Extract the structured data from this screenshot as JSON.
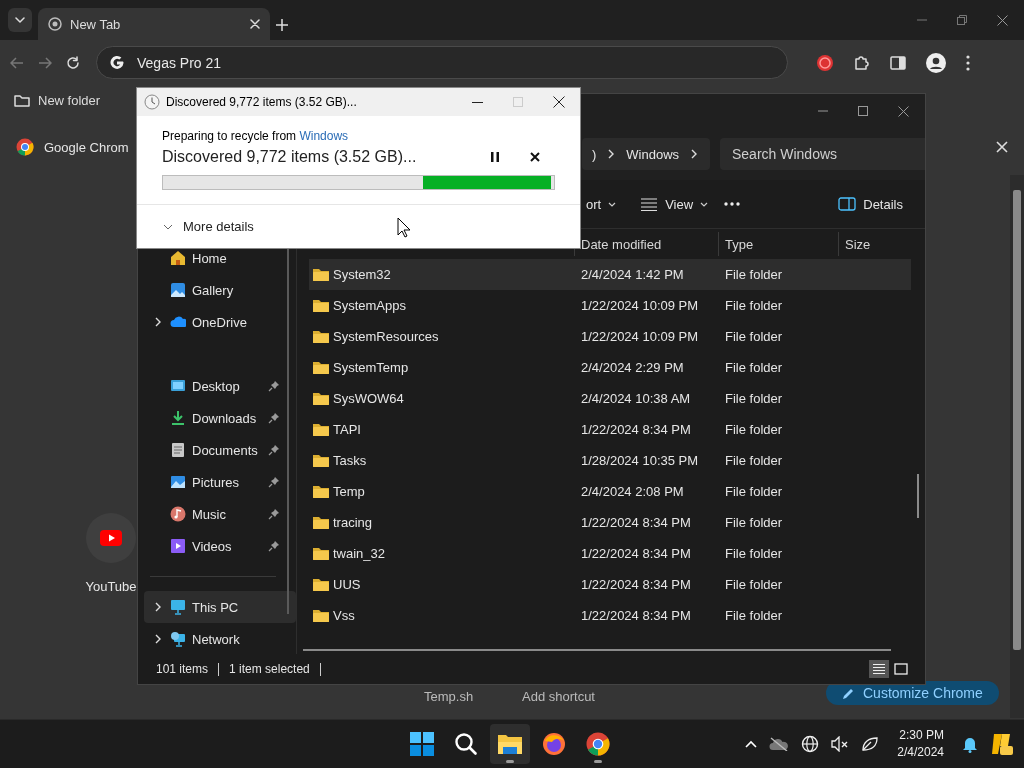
{
  "browser": {
    "tabs": [
      {
        "title": "New Tab",
        "selected": true
      }
    ],
    "omnibox": {
      "value": "Vegas Pro 21"
    },
    "bookmarks": [
      {
        "label": "New folder"
      }
    ],
    "infobar": {
      "text": "Google Chrom"
    },
    "shortcuts": [
      {
        "label": "YouTube",
        "kind": "youtube"
      }
    ],
    "shortcut_labels": [
      "Temp.sh",
      "Add shortcut"
    ],
    "customize_button": "Customize Chrome"
  },
  "explorer": {
    "breadcrumb": [
      ")",
      "Windows"
    ],
    "search": {
      "placeholder": "Search Windows"
    },
    "toolbar": [
      {
        "label": "ort",
        "kind": "dropdown"
      },
      {
        "label": "View",
        "kind": "view"
      },
      {
        "kind": "more"
      },
      {
        "label": "Details",
        "kind": "details"
      }
    ],
    "sidebar": [
      {
        "divider": false,
        "items": [
          {
            "label": "Home",
            "kind": "home",
            "pinned": false,
            "has_children": false,
            "selected": false
          },
          {
            "label": "Gallery",
            "kind": "gallery",
            "pinned": false,
            "has_children": false,
            "selected": false
          },
          {
            "label": "OneDrive",
            "kind": "onedrive",
            "pinned": false,
            "has_children": true,
            "selected": false
          }
        ]
      },
      {
        "divider": false,
        "items": [
          {
            "label": "Desktop",
            "kind": "desktop",
            "pinned": true,
            "has_children": false,
            "selected": false
          },
          {
            "label": "Downloads",
            "kind": "downloads",
            "pinned": true,
            "has_children": false,
            "selected": false
          },
          {
            "label": "Documents",
            "kind": "documents",
            "pinned": true,
            "has_children": false,
            "selected": false
          },
          {
            "label": "Pictures",
            "kind": "pictures",
            "pinned": true,
            "has_children": false,
            "selected": false
          },
          {
            "label": "Music",
            "kind": "music",
            "pinned": true,
            "has_children": false,
            "selected": false
          },
          {
            "label": "Videos",
            "kind": "videos",
            "pinned": true,
            "has_children": false,
            "selected": false
          }
        ]
      },
      {
        "divider": true,
        "items": [
          {
            "label": "This PC",
            "kind": "thispc",
            "pinned": false,
            "has_children": true,
            "selected": true
          },
          {
            "label": "Network",
            "kind": "network",
            "pinned": false,
            "has_children": true,
            "selected": false
          }
        ]
      }
    ],
    "columns": [
      "Date modified",
      "Type",
      "Size"
    ],
    "rows": [
      {
        "name": "System32",
        "date": "2/4/2024 1:42 PM",
        "type": "File folder",
        "selected": true
      },
      {
        "name": "SystemApps",
        "date": "1/22/2024 10:09 PM",
        "type": "File folder",
        "selected": false
      },
      {
        "name": "SystemResources",
        "date": "1/22/2024 10:09 PM",
        "type": "File folder",
        "selected": false
      },
      {
        "name": "SystemTemp",
        "date": "2/4/2024 2:29 PM",
        "type": "File folder",
        "selected": false
      },
      {
        "name": "SysWOW64",
        "date": "2/4/2024 10:38 AM",
        "type": "File folder",
        "selected": false
      },
      {
        "name": "TAPI",
        "date": "1/22/2024 8:34 PM",
        "type": "File folder",
        "selected": false
      },
      {
        "name": "Tasks",
        "date": "1/28/2024 10:35 PM",
        "type": "File folder",
        "selected": false
      },
      {
        "name": "Temp",
        "date": "2/4/2024 2:08 PM",
        "type": "File folder",
        "selected": false
      },
      {
        "name": "tracing",
        "date": "1/22/2024 8:34 PM",
        "type": "File folder",
        "selected": false
      },
      {
        "name": "twain_32",
        "date": "1/22/2024 8:34 PM",
        "type": "File folder",
        "selected": false
      },
      {
        "name": "UUS",
        "date": "1/22/2024 8:34 PM",
        "type": "File folder",
        "selected": false
      },
      {
        "name": "Vss",
        "date": "1/22/2024 8:34 PM",
        "type": "File folder",
        "selected": false
      }
    ],
    "status": [
      "101 items",
      "1 item selected"
    ],
    "view_modes": [
      {
        "kind": "details",
        "selected": true
      },
      {
        "kind": "tiles",
        "selected": false
      }
    ]
  },
  "dialog": {
    "title": "Discovered 9,772 items (3.52 GB)...",
    "source_text": "Preparing to recycle from",
    "source_link": "Windows",
    "status": "Discovered 9,772 items (3.52 GB)...",
    "progress": {
      "level": 0.33
    },
    "more_details": {
      "label": "More details",
      "expanded": false
    }
  },
  "taskbar": {
    "apps": [
      {
        "kind": "start",
        "selected": false,
        "running": false
      },
      {
        "kind": "search",
        "selected": false,
        "running": false
      },
      {
        "kind": "explorer",
        "selected": true,
        "running": true
      },
      {
        "kind": "firefox",
        "selected": false,
        "running": false
      },
      {
        "kind": "chrome",
        "selected": false,
        "running": true
      }
    ],
    "time": "2:30 PM",
    "date": "2/4/2024"
  }
}
